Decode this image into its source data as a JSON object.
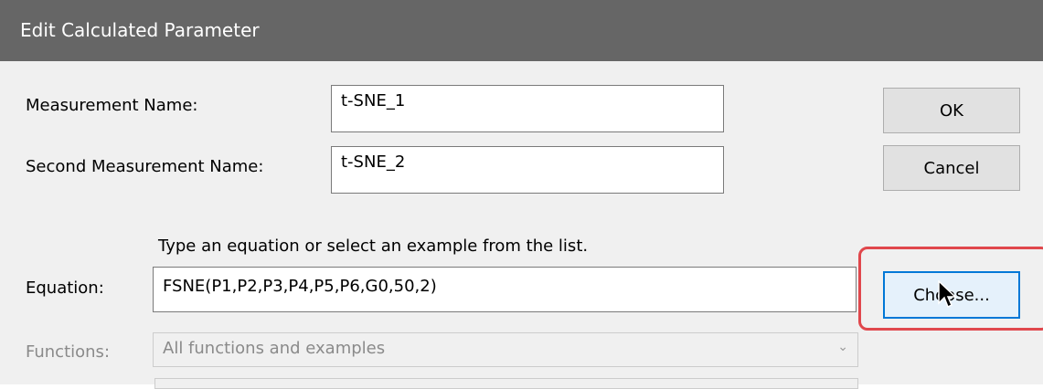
{
  "window": {
    "title": "Edit Calculated Parameter"
  },
  "measurement": {
    "label": "Measurement Name:",
    "value": "t-SNE_1"
  },
  "second_measurement": {
    "label": "Second Measurement Name:",
    "value": "t-SNE_2"
  },
  "buttons": {
    "ok": "OK",
    "cancel": "Cancel",
    "choose": "Choose..."
  },
  "hint": "Type an equation or select an example from the list.",
  "equation": {
    "label": "Equation:",
    "value": "FSNE(P1,P2,P3,P4,P5,P6,G0,50,2)"
  },
  "functions": {
    "label": "Functions:",
    "selected": "All functions and examples"
  },
  "colors": {
    "highlight": "#e0474c",
    "titlebar": "#666666",
    "focus": "#0078d7"
  },
  "icons": [
    "chevron-down-icon",
    "mouse-cursor-icon"
  ]
}
